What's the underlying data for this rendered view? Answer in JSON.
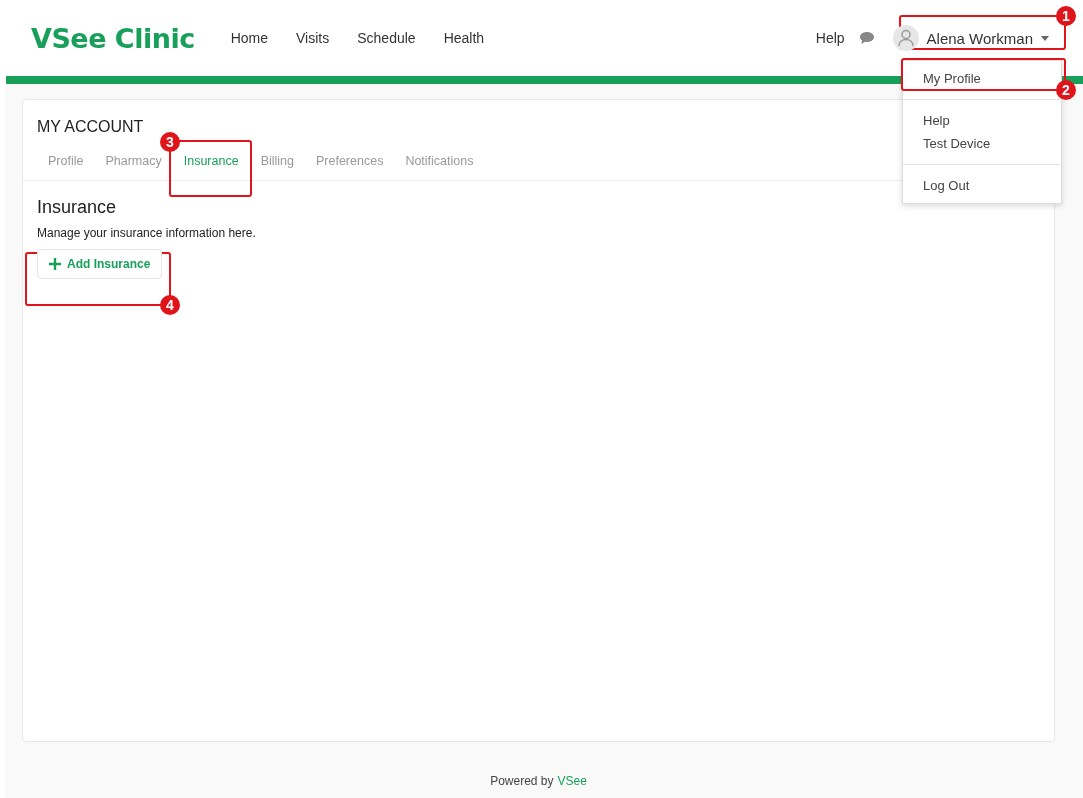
{
  "header": {
    "logo": "VSee Clinic",
    "nav": [
      {
        "label": "Home"
      },
      {
        "label": "Visits"
      },
      {
        "label": "Schedule"
      },
      {
        "label": "Health"
      }
    ],
    "help": "Help",
    "user": {
      "name": "Alena Workman",
      "menu_open": true
    }
  },
  "user_menu": [
    {
      "label": "My Profile",
      "kind": "item"
    },
    {
      "kind": "divider"
    },
    {
      "label": "Help",
      "kind": "item"
    },
    {
      "label": "Test Device",
      "kind": "item"
    },
    {
      "kind": "divider"
    },
    {
      "label": "Log Out",
      "kind": "item"
    }
  ],
  "account": {
    "title": "MY ACCOUNT",
    "tabs": [
      {
        "label": "Profile",
        "selected": false
      },
      {
        "label": "Pharmacy",
        "selected": false
      },
      {
        "label": "Insurance",
        "selected": true
      },
      {
        "label": "Billing",
        "selected": false
      },
      {
        "label": "Preferences",
        "selected": false
      },
      {
        "label": "Notifications",
        "selected": false
      }
    ],
    "section_title": "Insurance",
    "description": "Manage your insurance information here.",
    "add_button": "Add Insurance"
  },
  "annotations": [
    {
      "number": "1"
    },
    {
      "number": "2"
    },
    {
      "number": "3"
    },
    {
      "number": "4"
    }
  ],
  "footer": {
    "text": "Powered by",
    "link": "VSee"
  }
}
